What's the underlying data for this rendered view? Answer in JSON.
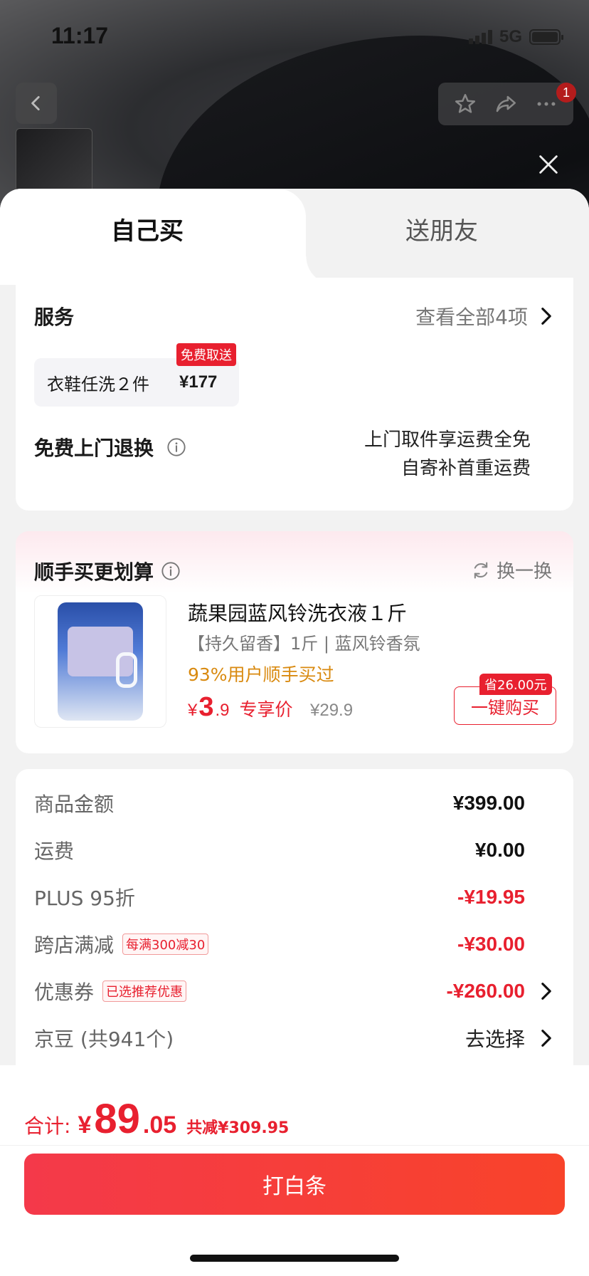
{
  "status_bar": {
    "time": "11:17",
    "network": "5G"
  },
  "tabs": [
    {
      "label": "自己买"
    },
    {
      "label": "送朋友"
    }
  ],
  "services": {
    "title": "服务",
    "view_all": "查看全部4项",
    "item": {
      "name": "衣鞋任洗２件",
      "price": "¥177",
      "tag": "免费取送"
    },
    "return": {
      "title": "免费上门退换",
      "desc_line1": "上门取件享运费全免",
      "desc_line2": "自寄补首重运费"
    }
  },
  "deal": {
    "title": "顺手买更划算",
    "swap_label": "换一换",
    "product": {
      "name": "蔬果园蓝风铃洗衣液１斤",
      "sub": "【持久留香】1斤 | 蓝风铃香氛",
      "buy_rate": "93%用户顺手买过",
      "price_yen": "¥",
      "price_int": "3",
      "price_dec": ".9",
      "price_label": "专享价",
      "original_price": "¥29.9",
      "save_tag": "省26.00元",
      "buy_button": "一键购买"
    }
  },
  "summary": {
    "rows": [
      {
        "label": "商品金额",
        "value": "¥399.00"
      },
      {
        "label": "运费",
        "value": "¥0.00"
      },
      {
        "label": "PLUS 95折",
        "value": "-¥19.95"
      },
      {
        "label": "跨店满减",
        "tag": "每满300减30",
        "value": "-¥30.00"
      },
      {
        "label": "优惠券",
        "tag": "已选推荐优惠",
        "value": "-¥260.00"
      },
      {
        "label": "京豆 (共941个)",
        "value": "去选择"
      }
    ]
  },
  "footer": {
    "total_label": "合计:",
    "total_yen": "¥",
    "total_int": "89",
    "total_dec": ".05",
    "discount_text": "共减¥309.95",
    "pay_button": "打白条"
  },
  "colors": {
    "accent": "#e8202f",
    "orange": "#d98a10"
  },
  "cart_badge": "1"
}
